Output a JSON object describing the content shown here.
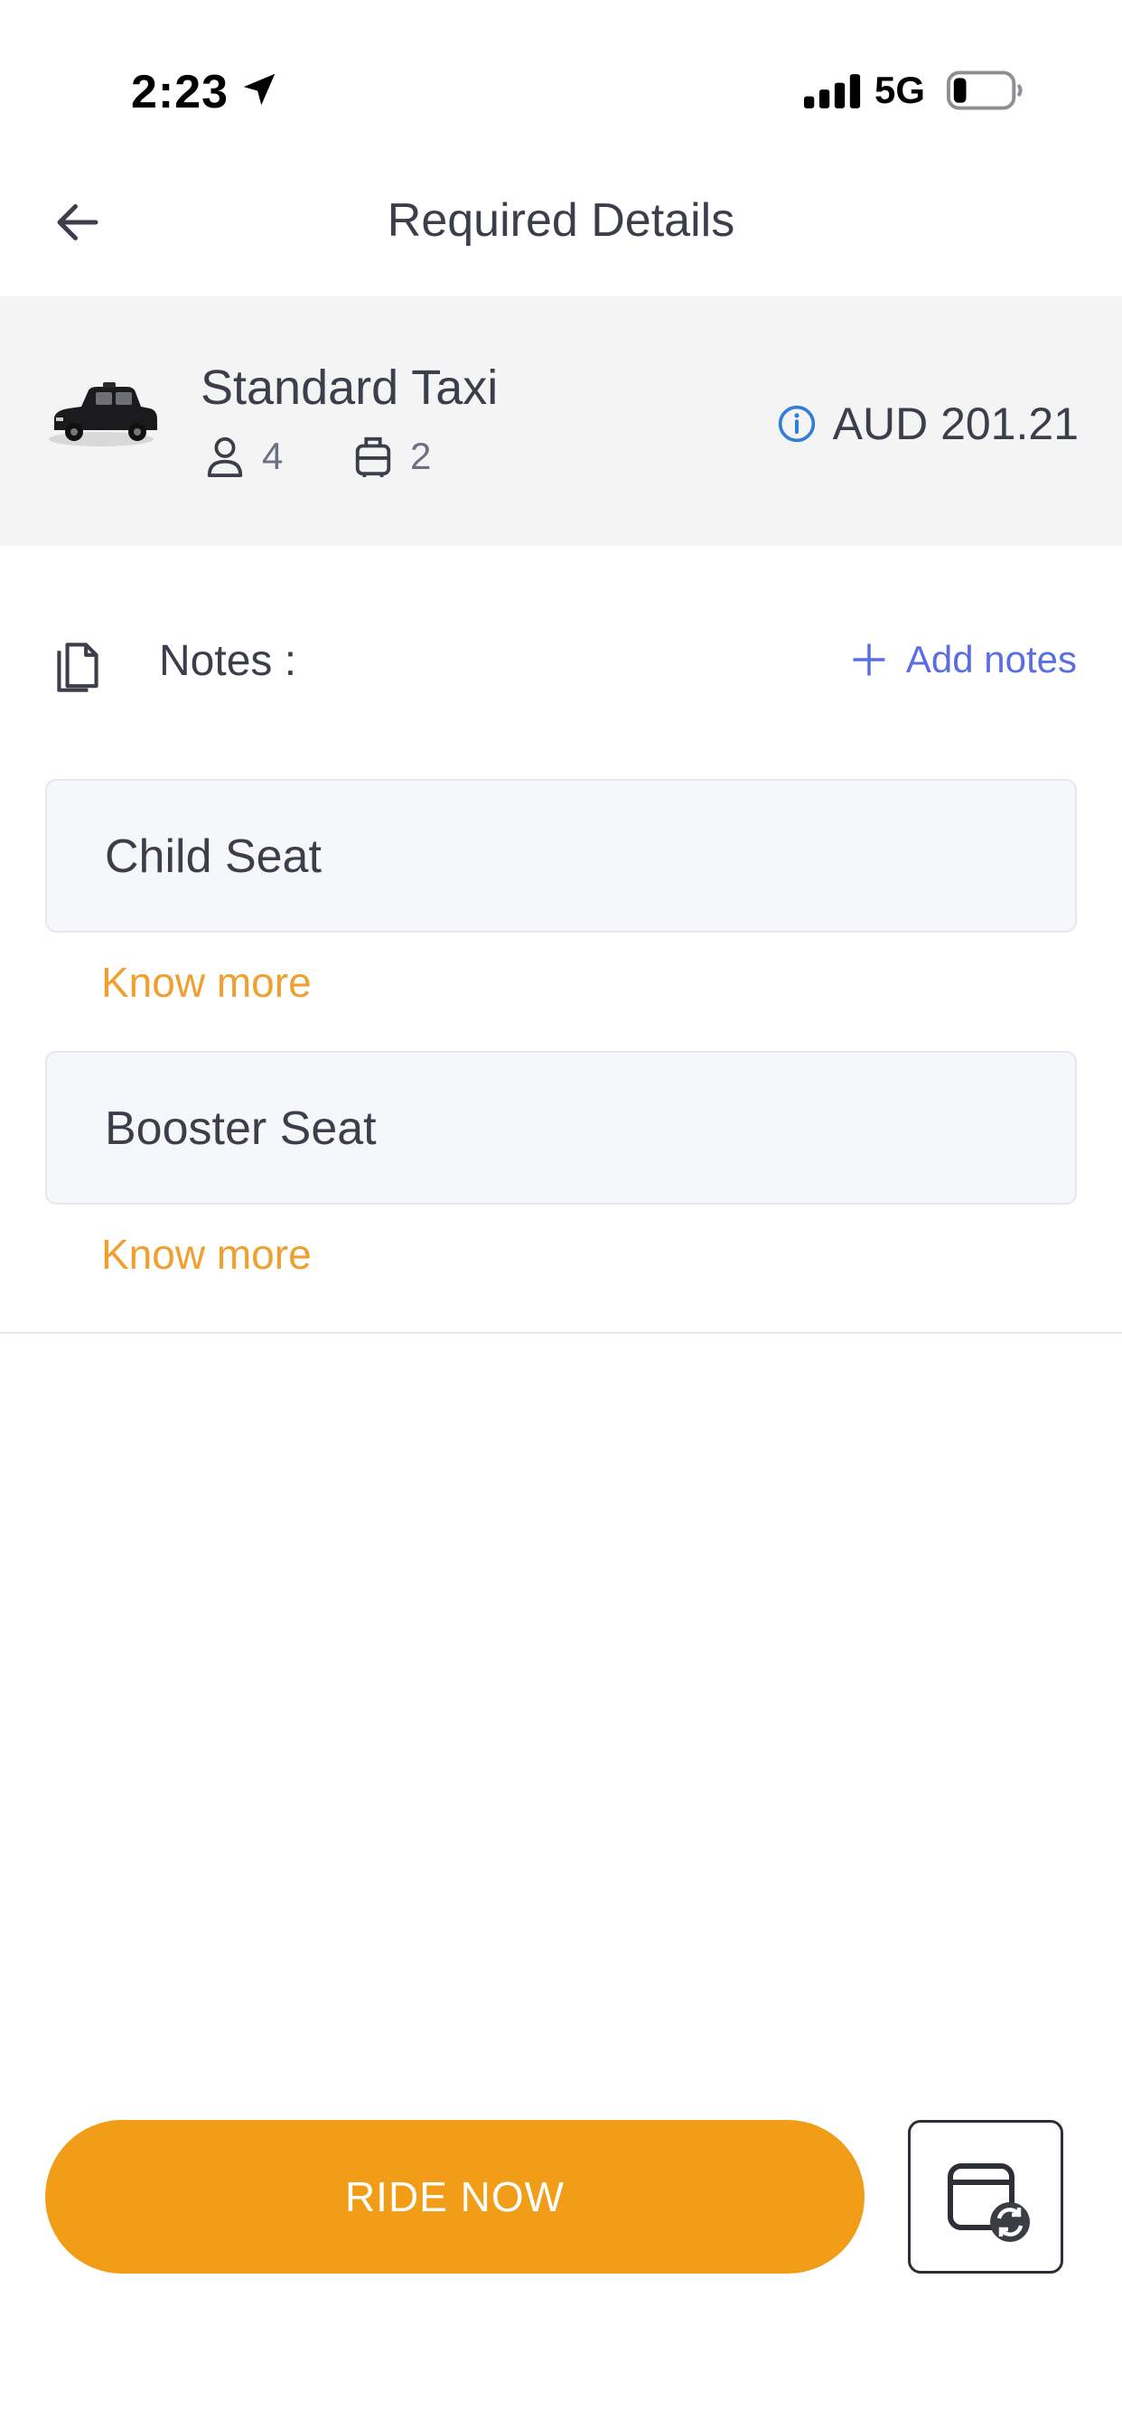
{
  "status_bar": {
    "time": "2:23",
    "network": "5G",
    "icons": [
      "location-arrow-icon",
      "signal-icon",
      "battery-icon"
    ]
  },
  "header": {
    "title": "Required Details",
    "back_icon": "back-arrow-icon"
  },
  "vehicle": {
    "name": "Standard Taxi",
    "passengers": "4",
    "luggage": "2",
    "fare": "AUD 201.21",
    "icons": [
      "taxi-car-image",
      "passenger-icon",
      "luggage-icon",
      "info-icon"
    ]
  },
  "notes": {
    "label": "Notes :",
    "add_label": "Add notes"
  },
  "options": [
    {
      "label": "Child Seat",
      "link": "Know more"
    },
    {
      "label": "Booster Seat",
      "link": "Know more"
    }
  ],
  "actions": {
    "ride_now": "RIDE NOW",
    "schedule_icon": "calendar-refresh-icon"
  },
  "colors": {
    "accent": "#f29d17",
    "link_orange": "#f0a030",
    "notes_blue": "#5b6ee1",
    "info_blue": "#2f7fd8",
    "card_bg": "#f4f4f5"
  }
}
